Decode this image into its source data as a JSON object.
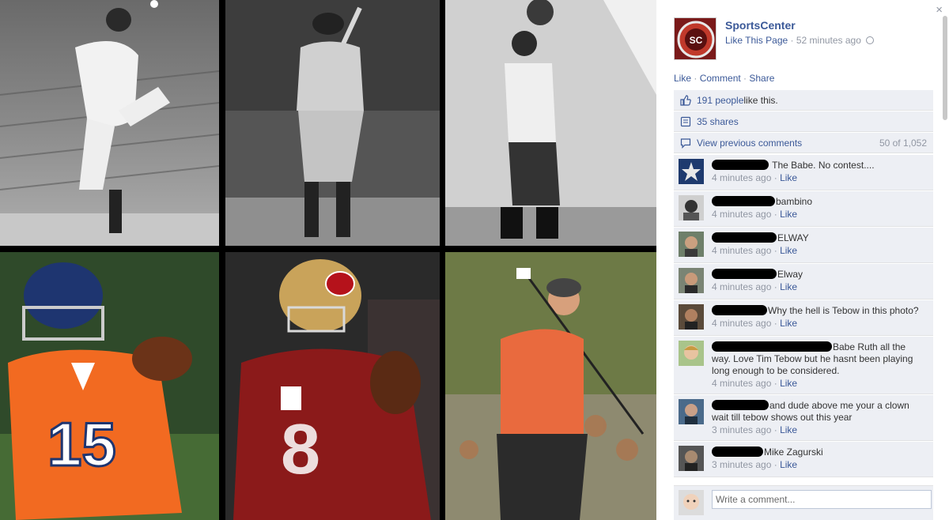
{
  "post": {
    "page_name": "SportsCenter",
    "like_page_label": "Like This Page",
    "separator": " · ",
    "timestamp": "52 minutes ago"
  },
  "photo_tiles": [
    {
      "name": "photo-pitcher"
    },
    {
      "name": "photo-batter"
    },
    {
      "name": "photo-basketball-player"
    },
    {
      "name": "photo-quarterback-broncos"
    },
    {
      "name": "photo-quarterback-49ers"
    },
    {
      "name": "photo-golfer"
    }
  ],
  "actions": {
    "like": "Like",
    "comment": "Comment",
    "share": "Share",
    "sep": " · "
  },
  "ufi": {
    "likes_link": "191 people",
    "likes_suffix": " like this.",
    "shares": "35 shares",
    "view_previous": "View previous comments",
    "comment_count": "50 of 1,052"
  },
  "comments": [
    {
      "text": "The Babe. No contest....",
      "time": "4 minutes ago",
      "like": "Like"
    },
    {
      "text": "bambino",
      "time": "4 minutes ago",
      "like": "Like"
    },
    {
      "text": "ELWAY",
      "time": "4 minutes ago",
      "like": "Like"
    },
    {
      "text": "Elway",
      "time": "4 minutes ago",
      "like": "Like"
    },
    {
      "text": "Why the hell is Tebow in this photo?",
      "time": "4 minutes ago",
      "like": "Like"
    },
    {
      "text": "Babe Ruth all the way. Love Tim Tebow but he hasnt been playing long enough to be considered.",
      "time": "4 minutes ago",
      "like": "Like"
    },
    {
      "text": "and dude above me your a clown wait till tebow shows out this year",
      "time": "3 minutes ago",
      "like": "Like"
    },
    {
      "text": "Mike Zagurski",
      "time": "3 minutes ago",
      "like": "Like"
    }
  ],
  "write_comment": {
    "placeholder": "Write a comment..."
  },
  "close_glyph": "×",
  "colors": {
    "link": "#3b5998",
    "meta": "#9197a3",
    "ufi_bg": "#edeff4",
    "broncos_orange": "#f26a21",
    "niners_red": "#8b1a1a",
    "golf_shirt": "#e96a3e"
  },
  "icons": [
    "thumbs-up-icon",
    "share-icon",
    "comment-bubble-icon",
    "globe-icon",
    "close-icon"
  ]
}
